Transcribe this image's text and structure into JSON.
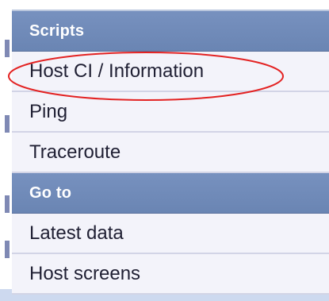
{
  "menu": {
    "sections": [
      {
        "header": "Scripts",
        "items": [
          {
            "label": "Host CI / Information",
            "highlighted": true
          },
          {
            "label": "Ping"
          },
          {
            "label": "Traceroute"
          }
        ]
      },
      {
        "header": "Go to",
        "items": [
          {
            "label": "Latest data"
          },
          {
            "label": "Host screens"
          }
        ]
      }
    ]
  },
  "colors": {
    "header_bg": "#6f89b8",
    "item_bg": "#f3f3fa",
    "highlight_ellipse": "#e32222"
  }
}
